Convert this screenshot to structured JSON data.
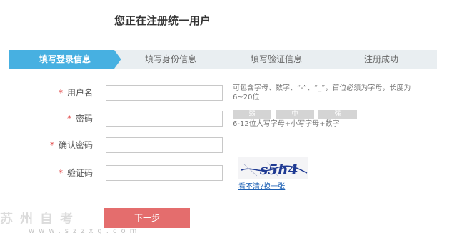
{
  "page_title": "您正在注册统一用户",
  "steps": [
    {
      "label": "填写登录信息",
      "active": true
    },
    {
      "label": "填写身份信息",
      "active": false
    },
    {
      "label": "填写验证信息",
      "active": false
    },
    {
      "label": "注册成功",
      "active": false
    }
  ],
  "form": {
    "required_mark": "*",
    "username": {
      "label": "用户名",
      "value": "",
      "hint": "可包含字母、数字、“-”、“_”，首位必须为字母，长度为6~20位"
    },
    "password": {
      "label": "密码",
      "value": "",
      "hint": "6-12位大写字母+小写字母+数字"
    },
    "confirm_password": {
      "label": "确认密码",
      "value": ""
    },
    "captcha": {
      "label": "验证码",
      "value": "",
      "image_text": "s5h4",
      "refresh_text": "看不清?换一张"
    }
  },
  "strength": {
    "weak": "弱",
    "medium": "中",
    "strong": "强"
  },
  "next_button": "下一步",
  "watermark": {
    "text": "苏州自考",
    "url": "www.szzxg.com"
  },
  "colors": {
    "accent": "#47b0e1",
    "button": "#e46d6d",
    "required": "#e04040"
  }
}
